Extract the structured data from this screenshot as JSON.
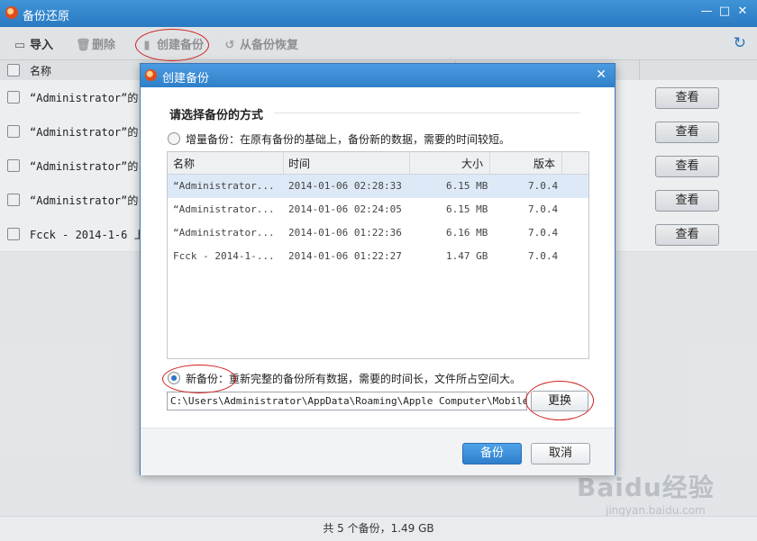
{
  "window": {
    "title": "备份还原",
    "controls": {
      "minimize": "—",
      "maximize": "□",
      "close": "✕"
    }
  },
  "toolbar": {
    "import_label": "导入",
    "delete_label": "删除",
    "create_label": "创建备份",
    "restore_label": "从备份恢复",
    "refresh_icon": "refresh-icon"
  },
  "list": {
    "header_name": "名称",
    "rows": [
      {
        "name": "“Administrator”的",
        "button": "查看"
      },
      {
        "name": "“Administrator”的",
        "button": "查看"
      },
      {
        "name": "“Administrator”的",
        "button": "查看"
      },
      {
        "name": "“Administrator”的",
        "button": "查看"
      },
      {
        "name": "Fcck - 2014-1-6 上午",
        "button": "查看"
      }
    ]
  },
  "status": {
    "text": "共 5 个备份，1.49 GB"
  },
  "dialog": {
    "title": "创建备份",
    "close": "✕",
    "heading": "请选择备份的方式",
    "incremental_label": "增量备份：在原有备份的基础上，备份新的数据，需要的时间较短。",
    "table": {
      "headers": [
        "名称",
        "时间",
        "大小",
        "版本"
      ],
      "rows": [
        {
          "name": "“Administrator...",
          "time": "2014-01-06 02:28:33",
          "size": "6.15 MB",
          "version": "7.0.4",
          "selected": true
        },
        {
          "name": "“Administrator...",
          "time": "2014-01-06 02:24:05",
          "size": "6.15 MB",
          "version": "7.0.4",
          "selected": false
        },
        {
          "name": "“Administrator...",
          "time": "2014-01-06 01:22:36",
          "size": "6.16 MB",
          "version": "7.0.4",
          "selected": false
        },
        {
          "name": "Fcck - 2014-1-...",
          "time": "2014-01-06 01:22:27",
          "size": "1.47 GB",
          "version": "7.0.4",
          "selected": false
        }
      ]
    },
    "new_backup_label": "新备份：重新完整的备份所有数据，需要的时间长，文件所占空间大。",
    "path_value": "C:\\Users\\Administrator\\AppData\\Roaming\\Apple Computer\\MobileSync\\",
    "change_button": "更换",
    "ok_button": "备份",
    "cancel_button": "取消"
  },
  "watermark": {
    "text": "Baidu经验",
    "url": "jingyan.baidu.com"
  },
  "colors": {
    "titlebar": "#2a7ac2",
    "accent": "#2f80c9",
    "annotation": "#d0201e"
  }
}
